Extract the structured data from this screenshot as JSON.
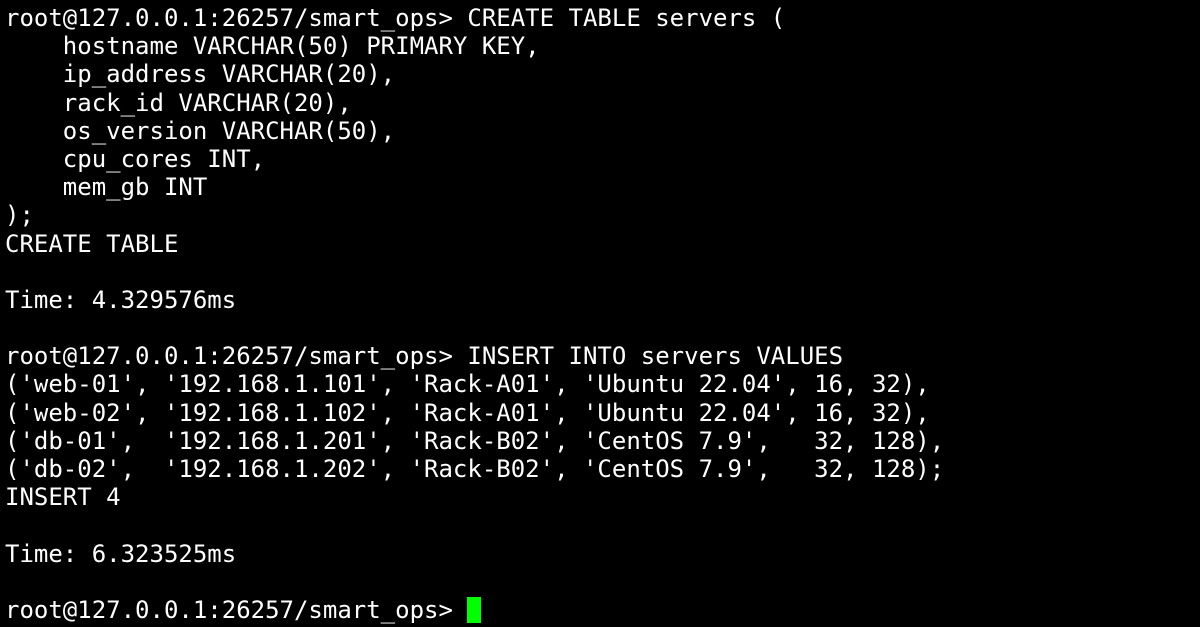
{
  "colors": {
    "background": "#000000",
    "foreground": "#ffffff",
    "cursor": "#00ff00"
  },
  "terminal": {
    "lines": [
      "root@127.0.0.1:26257/smart_ops> CREATE TABLE servers (",
      "    hostname VARCHAR(50) PRIMARY KEY,",
      "    ip_address VARCHAR(20),",
      "    rack_id VARCHAR(20),",
      "    os_version VARCHAR(50),",
      "    cpu_cores INT,",
      "    mem_gb INT",
      ");",
      "CREATE TABLE",
      "",
      "Time: 4.329576ms",
      "",
      "root@127.0.0.1:26257/smart_ops> INSERT INTO servers VALUES",
      "('web-01', '192.168.1.101', 'Rack-A01', 'Ubuntu 22.04', 16, 32),",
      "('web-02', '192.168.1.102', 'Rack-A01', 'Ubuntu 22.04', 16, 32),",
      "('db-01',  '192.168.1.201', 'Rack-B02', 'CentOS 7.9',   32, 128),",
      "('db-02',  '192.168.1.202', 'Rack-B02', 'CentOS 7.9',   32, 128);",
      "INSERT 4",
      "",
      "Time: 6.323525ms",
      ""
    ],
    "prompt": "root@127.0.0.1:26257/smart_ops> "
  }
}
